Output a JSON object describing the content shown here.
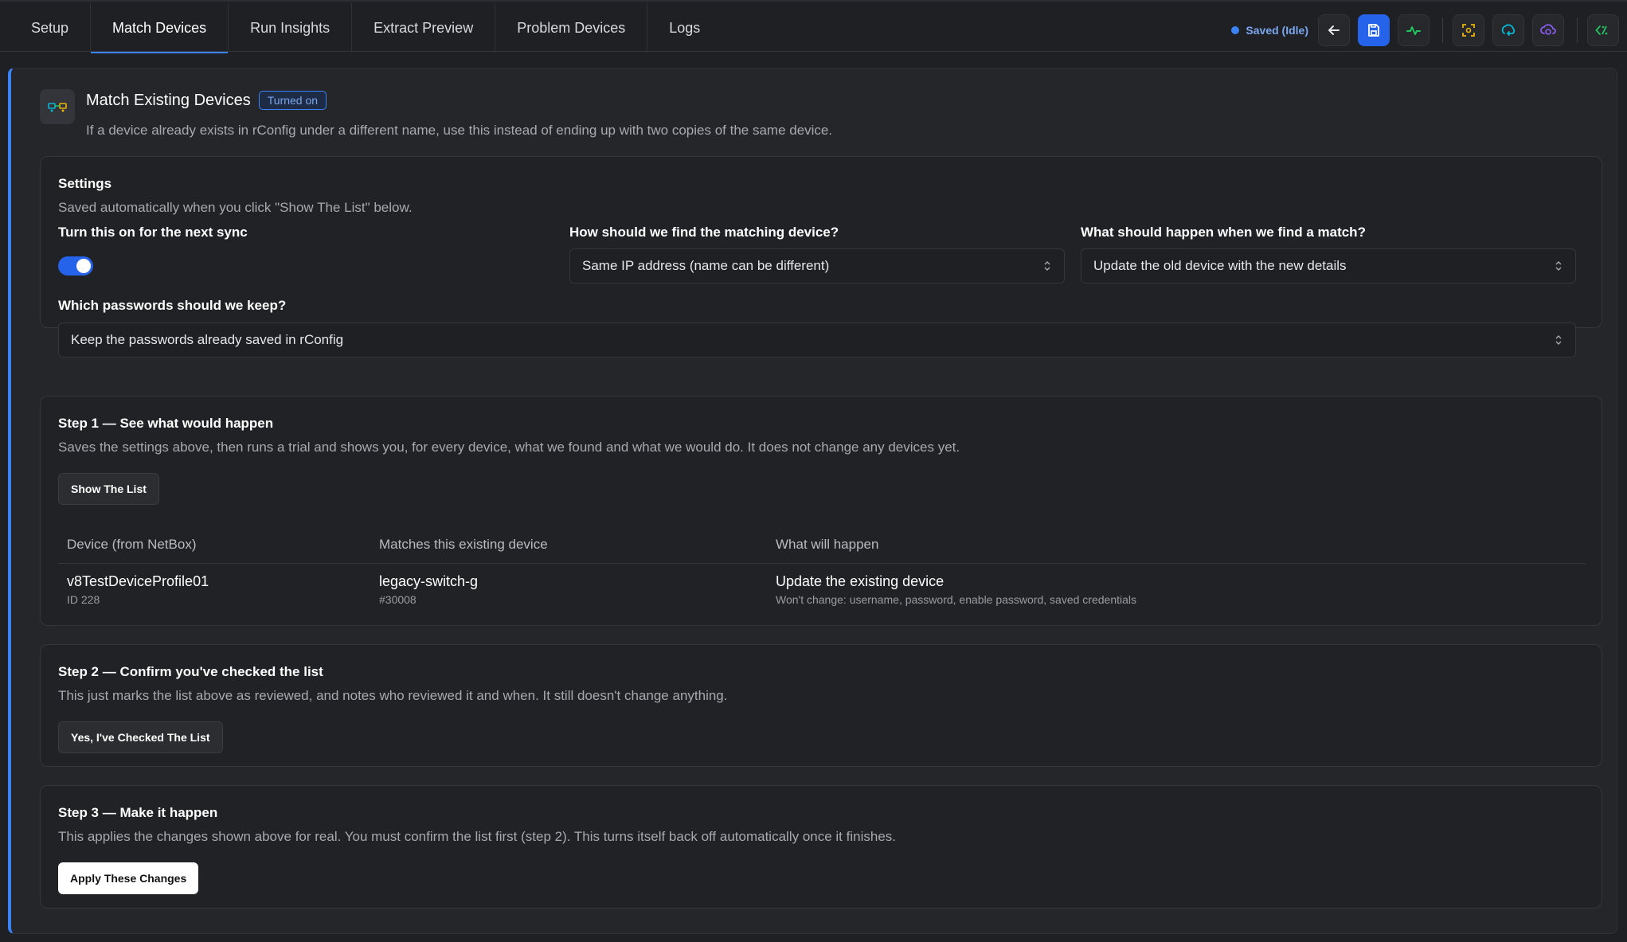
{
  "tabs": [
    {
      "label": "Setup"
    },
    {
      "label": "Match Devices",
      "active": true
    },
    {
      "label": "Run Insights"
    },
    {
      "label": "Extract Preview"
    },
    {
      "label": "Problem Devices"
    },
    {
      "label": "Logs"
    }
  ],
  "toolbar": {
    "status_text": "Saved (Idle)",
    "buttons": [
      "back-arrow-icon",
      "save-icon",
      "activity-icon",
      "scan-icon",
      "sync-icon",
      "cloud-refresh-icon",
      "code-icon"
    ]
  },
  "header": {
    "title": "Match Existing Devices",
    "badge": "Turned on",
    "description": "If a device already exists in rConfig under a different name, use this instead of ending up with two copies of the same device."
  },
  "settings": {
    "title": "Settings",
    "subtitle": "Saved automatically when you click \"Show The List\" below.",
    "toggle_label": "Turn this on for the next sync",
    "toggle_on": true,
    "match_label": "How should we find the matching device?",
    "match_value": "Same IP address (name can be different)",
    "action_label": "What should happen when we find a match?",
    "action_value": "Update the old device with the new details",
    "passwords_label": "Which passwords should we keep?",
    "passwords_value": "Keep the passwords already saved in rConfig"
  },
  "step1": {
    "title": "Step 1 — See what would happen",
    "description": "Saves the settings above, then runs a trial and shows you, for every device, what we found and what we would do. It does not change any devices yet.",
    "button": "Show The List",
    "table": {
      "headers": [
        "Device (from NetBox)",
        "Matches this existing device",
        "What will happen"
      ],
      "rows": [
        {
          "device": "v8TestDeviceProfile01",
          "device_sub": "ID 228",
          "match": "legacy-switch-g",
          "match_sub": "#30008",
          "action": "Update the existing device",
          "action_sub": "Won't change: username, password, enable password, saved credentials"
        }
      ]
    }
  },
  "step2": {
    "title": "Step 2 — Confirm you've checked the list",
    "description": "This just marks the list above as reviewed, and notes who reviewed it and when. It still doesn't change anything.",
    "button": "Yes, I've Checked The List"
  },
  "step3": {
    "title": "Step 3 — Make it happen",
    "description": "This applies the changes shown above for real. You must confirm the list first (step 2). This turns itself back off automatically once it finishes.",
    "button": "Apply These Changes"
  },
  "colors": {
    "accent": "#3b82f6",
    "activity": "#22c55e",
    "scan": "#eab308",
    "sync": "#06b6d4",
    "cloud": "#8b5cf6"
  }
}
